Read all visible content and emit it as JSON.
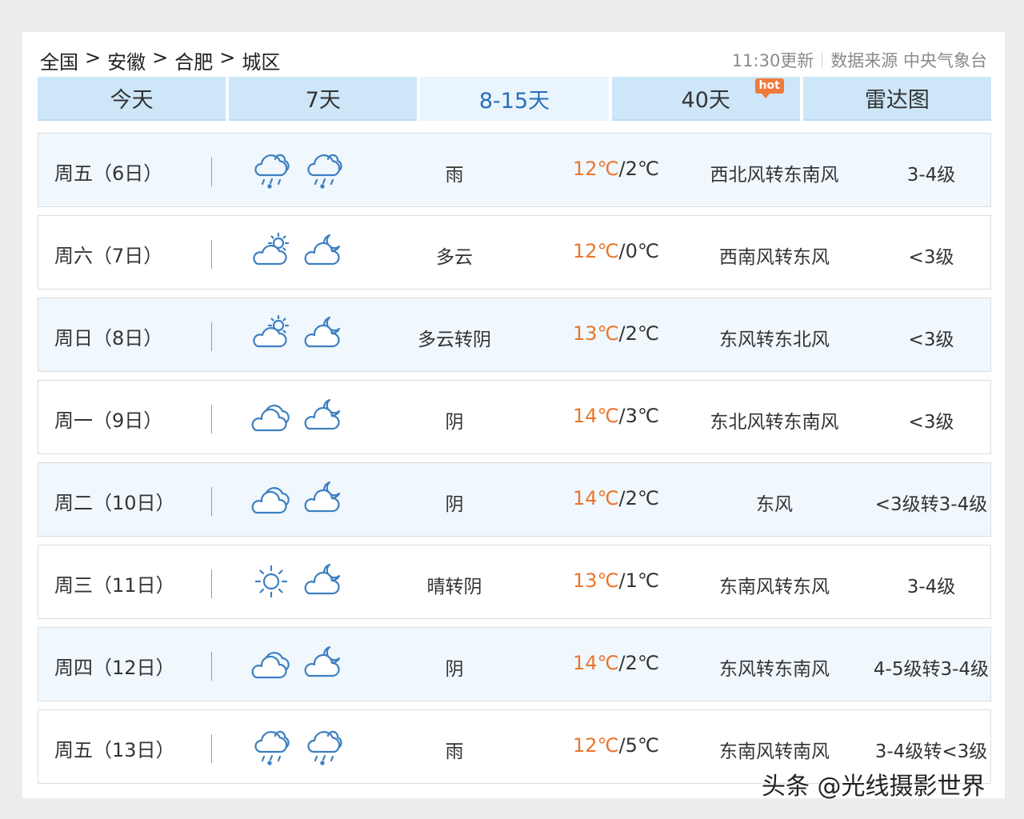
{
  "breadcrumb": {
    "country": "全国",
    "province": "安徽",
    "city": "合肥",
    "district": "城区",
    "separator": ">"
  },
  "update": {
    "time_label": "11:30更新",
    "source_label": "数据来源 中央气象台"
  },
  "tabs": [
    {
      "label": "今天",
      "active": false
    },
    {
      "label": "7天",
      "active": false
    },
    {
      "label": "8-15天",
      "active": true
    },
    {
      "label": "40天",
      "active": false,
      "badge": "hot"
    },
    {
      "label": "雷达图",
      "active": false
    }
  ],
  "colors": {
    "high_temp": "#e8762d",
    "active_tab_text": "#2a6fb8",
    "tab_bg": "#cde6f8",
    "icon_blue": "#3d7fc0"
  },
  "forecast": [
    {
      "date": "周五（6日）",
      "icon_day": "rain-cloud-icon",
      "icon_night": "rain-cloud-icon",
      "condition": "雨",
      "high": "12℃",
      "low": "/2℃",
      "wind": "西北风转东南风",
      "level": "3-4级"
    },
    {
      "date": "周六（7日）",
      "icon_day": "partly-cloudy-day-icon",
      "icon_night": "partly-cloudy-night-icon",
      "condition": "多云",
      "high": "12℃",
      "low": "/0℃",
      "wind": "西南风转东风",
      "level": "<3级"
    },
    {
      "date": "周日（8日）",
      "icon_day": "partly-cloudy-day-icon",
      "icon_night": "partly-cloudy-night-icon",
      "condition": "多云转阴",
      "high": "13℃",
      "low": "/2℃",
      "wind": "东风转东北风",
      "level": "<3级"
    },
    {
      "date": "周一（9日）",
      "icon_day": "overcast-icon",
      "icon_night": "partly-cloudy-night-icon",
      "condition": "阴",
      "high": "14℃",
      "low": "/3℃",
      "wind": "东北风转东南风",
      "level": "<3级"
    },
    {
      "date": "周二（10日）",
      "icon_day": "overcast-icon",
      "icon_night": "partly-cloudy-night-icon",
      "condition": "阴",
      "high": "14℃",
      "low": "/2℃",
      "wind": "东风",
      "level": "<3级转3-4级"
    },
    {
      "date": "周三（11日）",
      "icon_day": "sunny-icon",
      "icon_night": "partly-cloudy-night-icon",
      "condition": "晴转阴",
      "high": "13℃",
      "low": "/1℃",
      "wind": "东南风转东风",
      "level": "3-4级"
    },
    {
      "date": "周四（12日）",
      "icon_day": "overcast-icon",
      "icon_night": "partly-cloudy-night-icon",
      "condition": "阴",
      "high": "14℃",
      "low": "/2℃",
      "wind": "东风转东南风",
      "level": "4-5级转3-4级"
    },
    {
      "date": "周五（13日）",
      "icon_day": "rain-cloud-icon",
      "icon_night": "rain-cloud-icon",
      "condition": "雨",
      "high": "12℃",
      "low": "/5℃",
      "wind": "东南风转南风",
      "level": "3-4级转<3级"
    }
  ],
  "watermark": "头条 @光线摄影世界"
}
